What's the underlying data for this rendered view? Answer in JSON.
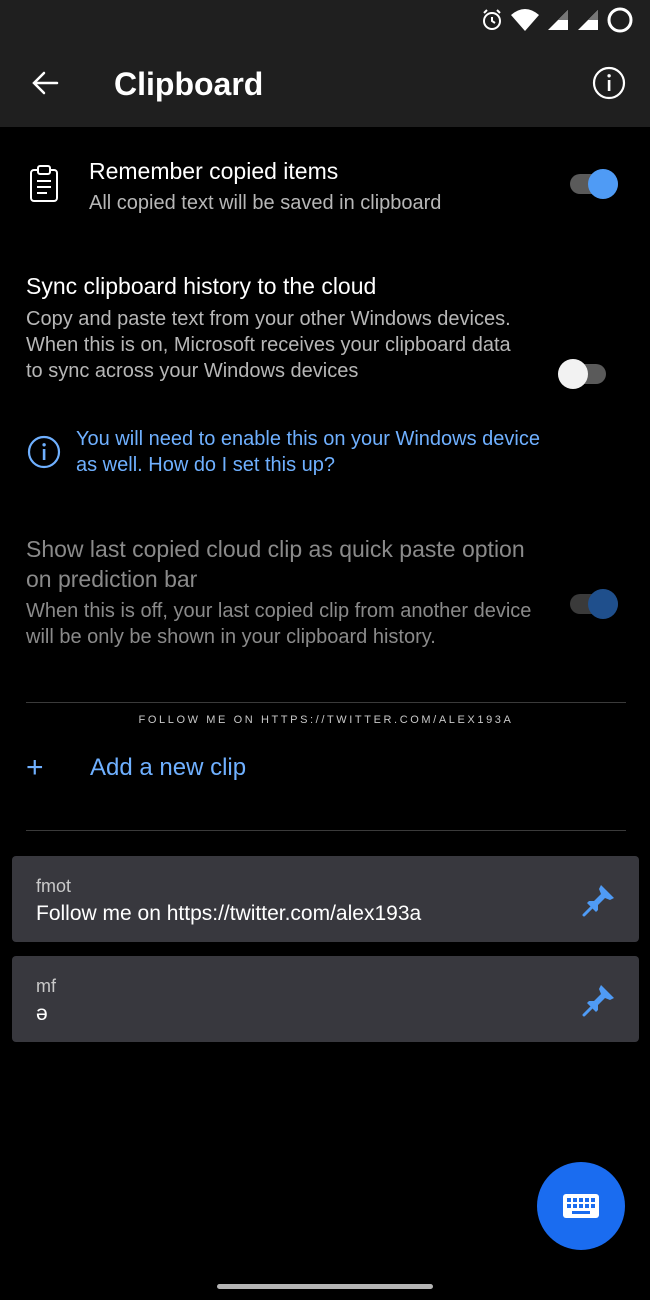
{
  "status_bar": {
    "icons": [
      "alarm-icon",
      "wifi-icon",
      "signal-icon",
      "signal-icon",
      "circle-icon"
    ]
  },
  "app_bar": {
    "title": "Clipboard",
    "back_icon": "arrow-left-icon",
    "info_icon": "info-icon"
  },
  "settings": {
    "remember": {
      "title": "Remember copied items",
      "description": "All copied text will be saved in clipboard",
      "enabled": true,
      "icon": "clipboard-icon"
    },
    "sync": {
      "title": "Sync clipboard history to the cloud",
      "description": "Copy and paste text from your other Windows devices. When this is on, Microsoft receives your clipboard data to sync across your Windows devices",
      "enabled": false,
      "note": "You will need to enable this on your Windows device as well. How do I set this up?"
    },
    "quick_paste": {
      "title": "Show last copied cloud clip as quick paste option on prediction bar",
      "description": "When this is off, your last copied clip from another device will be only be shown in your clipboard history.",
      "enabled": true,
      "disabled": true
    }
  },
  "watermark_banner": "FOLLOW ME ON HTTPS://TWITTER.COM/ALEX193A",
  "add_clip": {
    "label": "Add a new clip"
  },
  "clips": [
    {
      "key": "fmot",
      "text": "Follow me on https://twitter.com/alex193a",
      "pinned": true
    },
    {
      "key": "mf",
      "text": "ə",
      "pinned": true
    }
  ],
  "fab": {
    "icon": "keyboard-icon"
  },
  "colors": {
    "accent": "#4f9bf5",
    "link": "#6fb0ff",
    "fab": "#1a6cf0",
    "card": "#38383e"
  }
}
